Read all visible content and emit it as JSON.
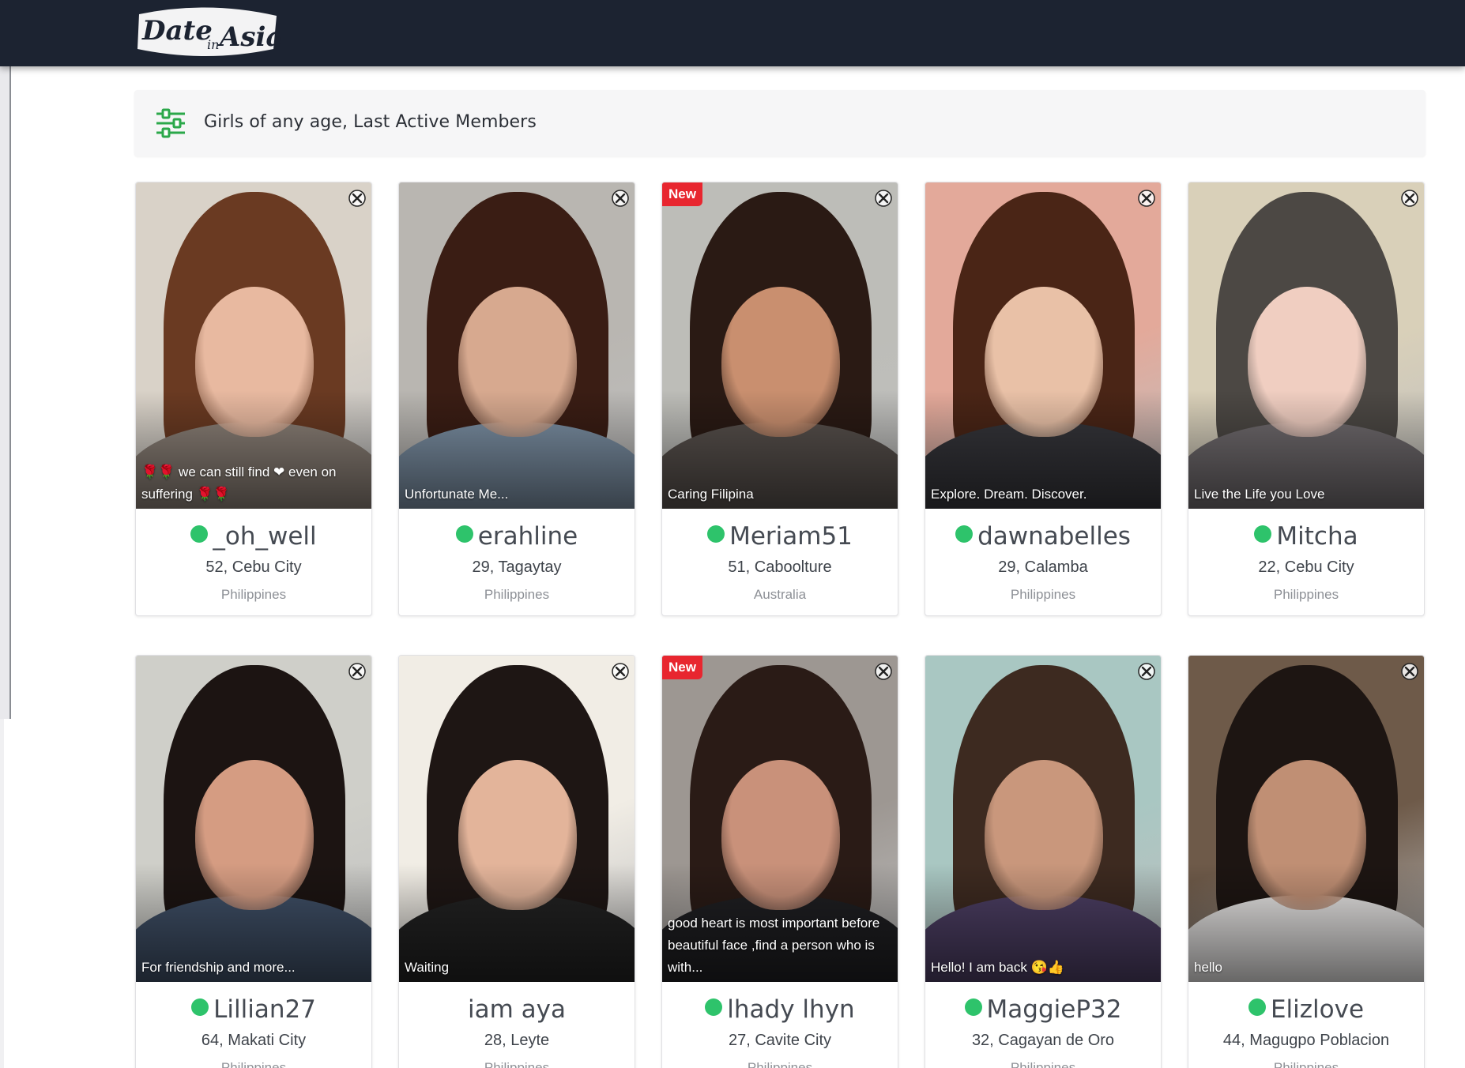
{
  "header": {
    "logo_text": "Date in Asia",
    "colors": {
      "background": "#1c2331"
    }
  },
  "filter": {
    "icon": "sliders-icon",
    "text": "Girls of any age, Last Active Members",
    "colors": {
      "icon": "#2ba84a"
    }
  },
  "accent": {
    "online": "#2ec36b",
    "new_badge": "#e8262f"
  },
  "profiles": [
    {
      "name": "_oh_well",
      "age_city": "52, Cebu City",
      "country": "Philippines",
      "caption": "🌹🌹 we can still find ❤ even on suffering 🌹🌹",
      "online": true,
      "is_new": false,
      "badge": "",
      "close_icon": "close-icon",
      "palette": {
        "bg": "#d9d2c8",
        "hair": "#6a3a22",
        "face": "#e8b9a0",
        "body": "#8a7f76"
      }
    },
    {
      "name": "erahline",
      "age_city": "29, Tagaytay",
      "country": "Philippines",
      "caption": "Unfortunate Me...",
      "online": true,
      "is_new": false,
      "badge": "",
      "close_icon": "close-icon",
      "palette": {
        "bg": "#b9b6b1",
        "hair": "#3a1d14",
        "face": "#d7a98f",
        "body": "#7b8fa3"
      }
    },
    {
      "name": "Meriam51",
      "age_city": "51, Caboolture",
      "country": "Australia",
      "caption": "Caring Filipina",
      "online": true,
      "is_new": true,
      "badge": "New",
      "close_icon": "close-icon",
      "palette": {
        "bg": "#bdbdb8",
        "hair": "#2a1a14",
        "face": "#c98f6f",
        "body": "#57504c"
      }
    },
    {
      "name": "dawnabelles",
      "age_city": "29, Calamba",
      "country": "Philippines",
      "caption": "Explore. Dream. Discover.",
      "online": true,
      "is_new": false,
      "badge": "",
      "close_icon": "close-icon",
      "palette": {
        "bg": "#e3a99a",
        "hair": "#4a2516",
        "face": "#e9c1a7",
        "body": "#35353a"
      }
    },
    {
      "name": "Mitcha",
      "age_city": "22, Cebu City",
      "country": "Philippines",
      "caption": "Live the Life you Love",
      "online": true,
      "is_new": false,
      "badge": "",
      "close_icon": "close-icon",
      "palette": {
        "bg": "#d9d0b9",
        "hair": "#4c4844",
        "face": "#f0cec1",
        "body": "#6f6a6d"
      }
    },
    {
      "name": "Lillian27",
      "age_city": "64, Makati City",
      "country": "Philippines",
      "caption": "For friendship and more...",
      "online": true,
      "is_new": false,
      "badge": "",
      "close_icon": "close-icon",
      "palette": {
        "bg": "#cfcfc9",
        "hair": "#1c1412",
        "face": "#d59c82",
        "body": "#3f4f66"
      }
    },
    {
      "name": "iam aya",
      "age_city": "28, Leyte",
      "country": "Philippines",
      "caption": "Waiting",
      "online": false,
      "is_new": false,
      "badge": "",
      "close_icon": "close-icon",
      "palette": {
        "bg": "#f1ede5",
        "hair": "#1e1614",
        "face": "#e3b49a",
        "body": "#222222"
      }
    },
    {
      "name": "lhady lhyn",
      "age_city": "27, Cavite City",
      "country": "Philippines",
      "caption": "good heart is most important before beautiful face ,find a person who is with...",
      "online": true,
      "is_new": true,
      "badge": "New",
      "close_icon": "close-icon",
      "palette": {
        "bg": "#9d9792",
        "hair": "#2a1b16",
        "face": "#c9917a",
        "body": "#1f1f22"
      }
    },
    {
      "name": "MaggieP32",
      "age_city": "32, Cagayan de Oro",
      "country": "Philippines",
      "caption": "Hello! I am back 😘👍",
      "online": true,
      "is_new": false,
      "badge": "",
      "close_icon": "close-icon",
      "palette": {
        "bg": "#a9c7c2",
        "hair": "#3d2a20",
        "face": "#c9977c",
        "body": "#4c3e63"
      }
    },
    {
      "name": "Elizlove",
      "age_city": "44, Magugpo Poblacion",
      "country": "Philippines",
      "caption": "hello",
      "online": true,
      "is_new": false,
      "badge": "",
      "close_icon": "close-icon",
      "palette": {
        "bg": "#6e5a49",
        "hair": "#1d1512",
        "face": "#c08f74",
        "body": "#e6e4e3"
      }
    }
  ]
}
